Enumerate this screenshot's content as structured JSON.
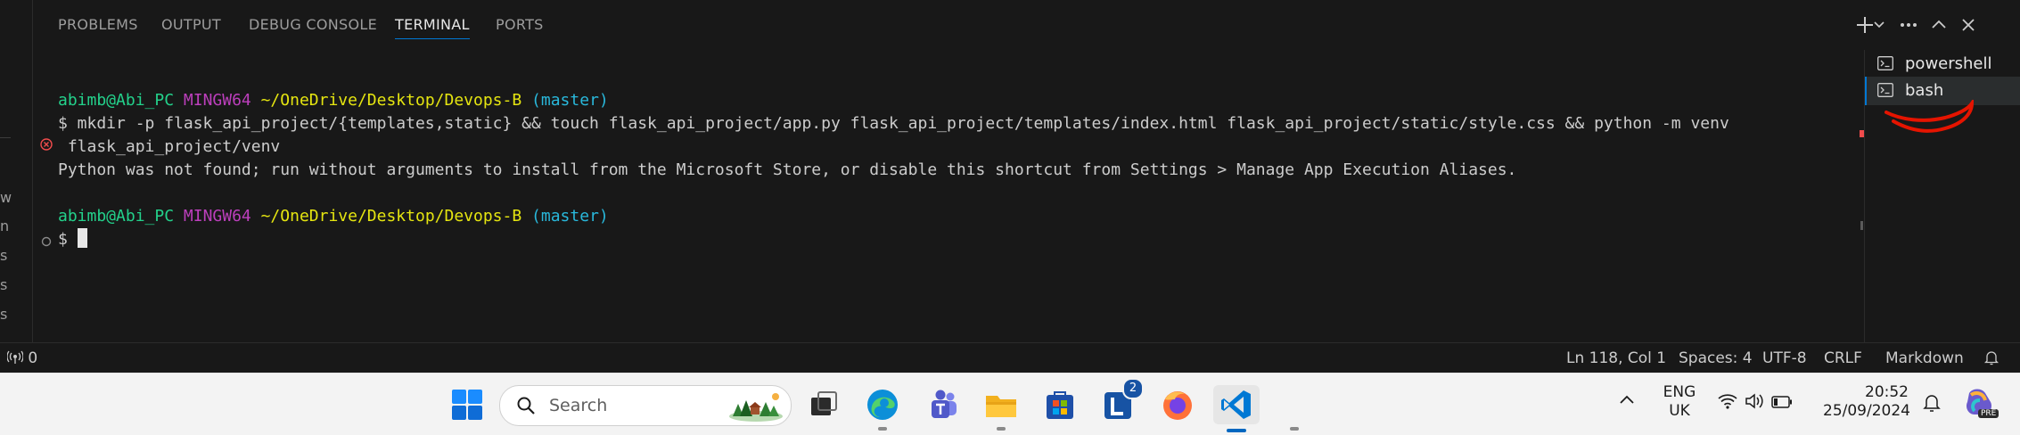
{
  "panel": {
    "tabs": [
      {
        "label": "PROBLEMS"
      },
      {
        "label": "OUTPUT"
      },
      {
        "label": "DEBUG CONSOLE"
      },
      {
        "label": "TERMINAL"
      },
      {
        "label": "PORTS"
      }
    ],
    "active_tab": "TERMINAL",
    "actions": {
      "new_terminal_icon": "plus-icon",
      "dropdown_icon": "chevron-down-icon",
      "more_icon": "ellipsis-icon",
      "maximize_icon": "chevron-up-icon",
      "close_icon": "close-icon"
    }
  },
  "left_strip": {
    "letters": [
      "w",
      "n",
      "s",
      "s",
      "s"
    ]
  },
  "terminal": {
    "prompt1": {
      "user": "abimb@Abi_PC",
      "env": "MINGW64",
      "path": "~/OneDrive/Desktop/Devops-B",
      "branch": "(master)"
    },
    "command_line1": "$ mkdir -p flask_api_project/{templates,static} && touch flask_api_project/app.py flask_api_project/templates/index.html flask_api_project/static/style.css && python -m venv",
    "command_line2": " flask_api_project/venv",
    "error_text": "Python was not found; run without arguments to install from the Microsoft Store, or disable this shortcut from Settings > Manage App Execution Aliases.",
    "prompt2": {
      "user": "abimb@Abi_PC",
      "env": "MINGW64",
      "path": "~/OneDrive/Desktop/Devops-B",
      "branch": "(master)"
    },
    "input_prompt": "$",
    "error_icon": "error-circle-icon",
    "idle_icon": "circle-icon"
  },
  "terminal_list": [
    {
      "label": "powershell",
      "icon": "terminal-icon"
    },
    {
      "label": "bash",
      "icon": "terminal-icon",
      "active": true
    }
  ],
  "status_bar": {
    "ports_icon": "broadcast-icon",
    "ports_count": "0",
    "cursor_position": "Ln 118, Col 1",
    "indentation": "Spaces: 4",
    "encoding": "UTF-8",
    "line_endings": "CRLF",
    "language": "Markdown",
    "notifications_icon": "bell-icon"
  },
  "taskbar": {
    "search_placeholder": "Search",
    "apps": [
      "windows-start-icon",
      "task-view-icon",
      "edge-icon",
      "teams-icon",
      "file-explorer-icon",
      "microsoft-store-icon",
      "l-app-icon",
      "firefox-icon",
      "vscode-icon"
    ],
    "l_app_badge": "2",
    "language_line1": "ENG",
    "language_line2": "UK",
    "time": "20:52",
    "date": "25/09/2024",
    "copilot_badge": "PRE"
  },
  "colors": {
    "accent": "#0078d4",
    "prompt_user": "#23d18b",
    "prompt_env": "#bc3fbc",
    "prompt_path": "#e5e510",
    "prompt_branch": "#29b8db",
    "error": "#f14c4c",
    "annotation": "#e51400"
  }
}
